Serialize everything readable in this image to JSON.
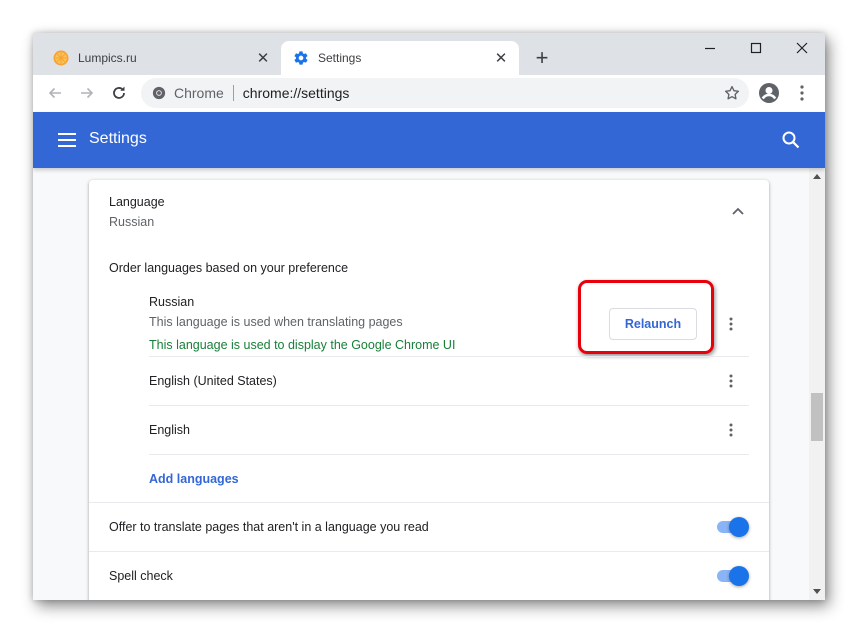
{
  "browser": {
    "tabs": [
      {
        "title": "Lumpics.ru",
        "icon": "orange-slice-favicon",
        "active": false
      },
      {
        "title": "Settings",
        "icon": "gear-icon",
        "active": true
      }
    ],
    "new_tab_symbol": "+",
    "close_symbol": "✕",
    "window_controls": [
      "minimize",
      "maximize",
      "close"
    ],
    "omnibox": {
      "origin_label": "Chrome",
      "url": "chrome://settings"
    }
  },
  "header": {
    "title": "Settings",
    "menu_icon": "hamburger-icon",
    "search_icon": "search-icon"
  },
  "language_section": {
    "title": "Language",
    "current_value": "Russian",
    "order_label": "Order languages based on your preference",
    "languages": [
      {
        "name": "Russian",
        "note": "This language is used when translating pages",
        "ui_note": "This language is used to display the Google Chrome UI",
        "action_label": "Relaunch"
      },
      {
        "name": "English (United States)"
      },
      {
        "name": "English"
      }
    ],
    "add_languages_label": "Add languages",
    "offer_translate_label": "Offer to translate pages that aren't in a language you read",
    "offer_translate_enabled": true,
    "spell_check_label": "Spell check",
    "spell_check_enabled": true
  },
  "colors": {
    "header_blue": "#3367d6",
    "link_blue": "#3367d6",
    "toggle_blue": "#1a73e8",
    "ui_note_green": "#188038",
    "highlight_red": "#e8000b"
  }
}
